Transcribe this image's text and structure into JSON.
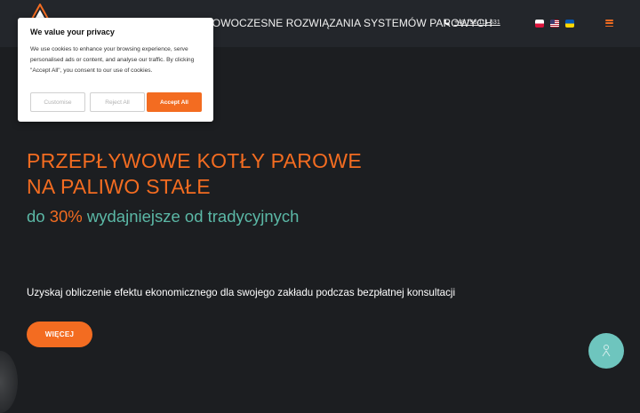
{
  "header": {
    "tagline": "NOWOCZESNE ROZWIĄZANIA SYSTEMÓW PAROWYCH",
    "phone": "+48 798 111 631",
    "logo_icon": "company-logo",
    "phone_icon": "phone-icon",
    "languages": [
      "pl",
      "en-us",
      "ua"
    ],
    "menu_icon": "hamburger-menu-icon"
  },
  "cookie_banner": {
    "title": "We value your privacy",
    "text": "We use cookies to enhance your browsing experience, serve personalised ads or content, and analyse our traffic. By clicking \"Accept All\", you consent to our use of cookies.",
    "customise_label": "Customise",
    "reject_label": "Reject All",
    "accept_label": "Accept All"
  },
  "hero": {
    "title_line1": "PRZEPŁYWOWE KOTŁY PAROWE",
    "title_line2": "NA PALIWO STAŁE",
    "subtitle_prefix": "do",
    "subtitle_highlight": "30%",
    "subtitle_suffix": "wydajniejsze od tradycyjnych",
    "description": "Uzyskaj obliczenie efektu ekonomicznego dla swojego zakładu podczas bezpłatnej konsultacji",
    "button_label": "WIĘCEJ"
  },
  "floating_button": {
    "icon": "chat-icon"
  },
  "colors": {
    "background": "#1c1e21",
    "header": "#23262b",
    "accent": "#f36c21",
    "teal": "#5bb8a6",
    "float_button": "#6ec5be"
  }
}
